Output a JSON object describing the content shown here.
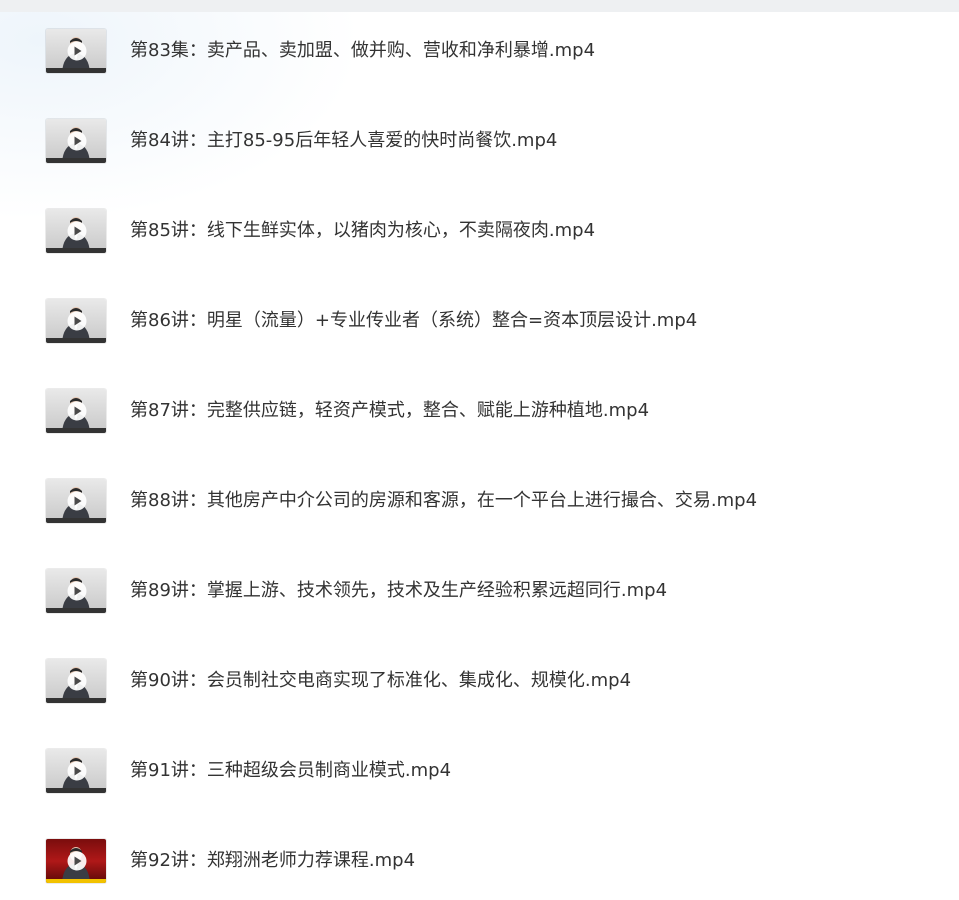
{
  "files": [
    {
      "name": "第83集：卖产品、卖加盟、做并购、营收和净利暴增.mp4",
      "thumb": "lecture"
    },
    {
      "name": "第84讲：主打85-95后年轻人喜爱的快时尚餐饮.mp4",
      "thumb": "lecture"
    },
    {
      "name": "第85讲：线下生鲜实体，以猪肉为核心，不卖隔夜肉.mp4",
      "thumb": "lecture"
    },
    {
      "name": "第86讲：明星（流量）+专业传业者（系统）整合=资本顶层设计.mp4",
      "thumb": "lecture"
    },
    {
      "name": "第87讲：完整供应链，轻资产模式，整合、赋能上游种植地.mp4",
      "thumb": "lecture"
    },
    {
      "name": "第88讲：其他房产中介公司的房源和客源，在一个平台上进行撮合、交易.mp4",
      "thumb": "lecture"
    },
    {
      "name": "第89讲：掌握上游、技术领先，技术及生产经验积累远超同行.mp4",
      "thumb": "lecture"
    },
    {
      "name": "第90讲：会员制社交电商实现了标准化、集成化、规模化.mp4",
      "thumb": "lecture"
    },
    {
      "name": "第91讲：三种超级会员制商业模式.mp4",
      "thumb": "lecture"
    },
    {
      "name": "第92讲：郑翔洲老师力荐课程.mp4",
      "thumb": "promo"
    }
  ],
  "icons": {
    "play": "play-icon",
    "thumbnail": "video-thumbnail"
  },
  "colors": {
    "text": "#333333",
    "background": "#ffffff",
    "promo_thumb": "#b01818"
  }
}
